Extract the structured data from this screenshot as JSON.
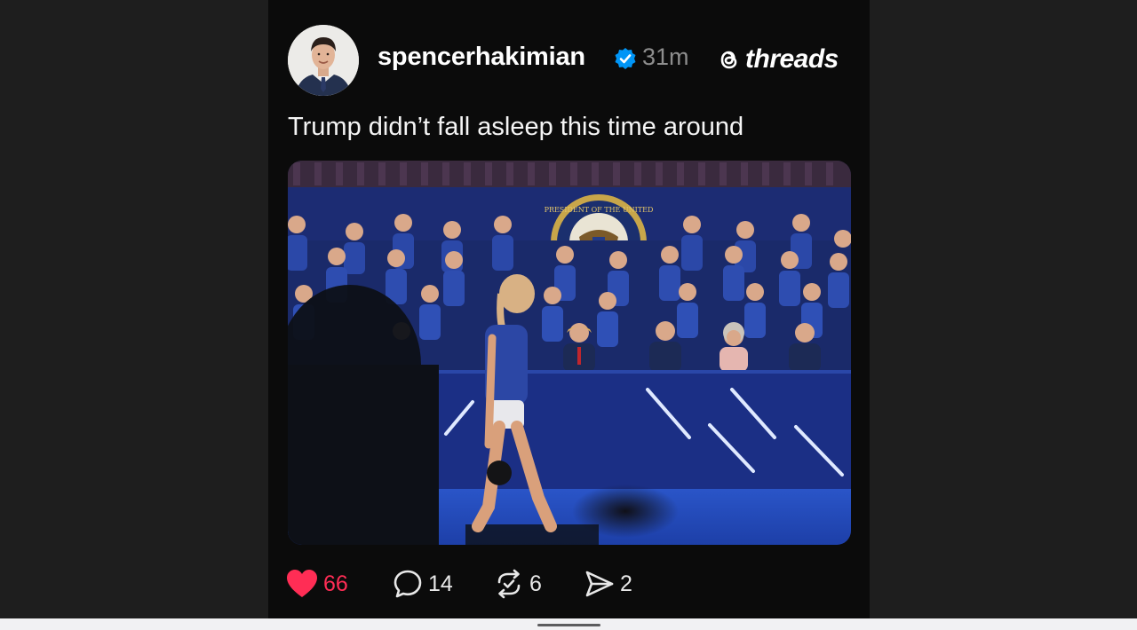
{
  "post": {
    "author": {
      "username": "spencerhakimian",
      "verified": true,
      "time_ago": "31m"
    },
    "brand": "threads",
    "caption": "Trump didn’t fall asleep this time around",
    "image": {
      "seal_text": "PRESIDENT OF THE UNITED"
    },
    "actions": {
      "likes": "66",
      "comments": "14",
      "reposts": "6",
      "shares": "2",
      "liked": true
    }
  },
  "colors": {
    "like_red": "#ff2d55",
    "verified_blue": "#0095f6",
    "post_background": "#0b0b0b",
    "side_background": "#1e1e1e"
  },
  "icons": {
    "like": "heart-filled-icon",
    "comment": "speech-bubble-icon",
    "repost": "repost-arrows-icon",
    "share": "paper-plane-icon",
    "verified": "verified-badge-icon",
    "brand": "threads-logo-icon"
  }
}
